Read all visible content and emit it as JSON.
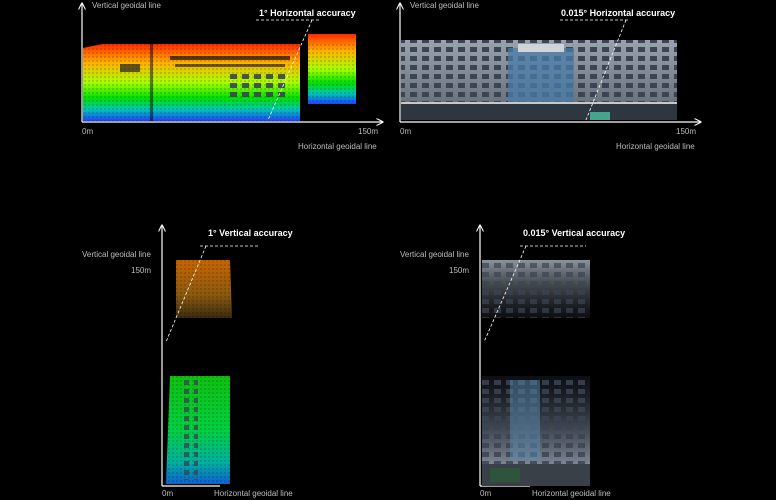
{
  "panels": [
    {
      "id": "top-left",
      "y_axis_label": "Vertical geoidal line",
      "x_axis_label": "Horizontal geoidal line",
      "x_start": "0m",
      "x_end": "150m",
      "annotation": "1° Horizontal accuracy",
      "render": "lidar-point-cloud"
    },
    {
      "id": "top-right",
      "y_axis_label": "Vertical geoidal line",
      "x_axis_label": "Horizontal geoidal line",
      "x_start": "0m",
      "x_end": "150m",
      "annotation": "0.015° Horizontal accuracy",
      "render": "photo-facade"
    },
    {
      "id": "bottom-left",
      "y_axis_label": "Vertical geoidal line",
      "x_axis_label": "Horizontal geoidal line",
      "x_start": "0m",
      "y_top": "150m",
      "annotation": "1° Vertical accuracy",
      "render": "lidar-point-cloud"
    },
    {
      "id": "bottom-right",
      "y_axis_label": "Vertical geoidal line",
      "x_axis_label": "Horizontal geoidal line",
      "x_start": "0m",
      "y_top": "150m",
      "annotation": "0.015° Vertical accuracy",
      "render": "photo-facade"
    }
  ],
  "colors": {
    "background": "#000000",
    "axis": "#ffffff",
    "label": "#bdbdbd"
  }
}
